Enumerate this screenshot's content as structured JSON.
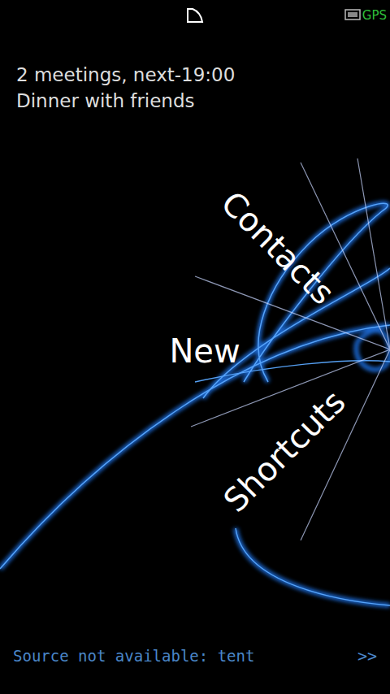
{
  "status_bar": {
    "gps": "GPS"
  },
  "agenda": [
    "2 meetings, next-19:00",
    "Dinner with friends"
  ],
  "menu": [
    {
      "label": "Contacts"
    },
    {
      "label": "New"
    },
    {
      "label": "Shortcuts"
    }
  ],
  "ticker": {
    "text": "Source not available: tent",
    "next": ">>"
  }
}
